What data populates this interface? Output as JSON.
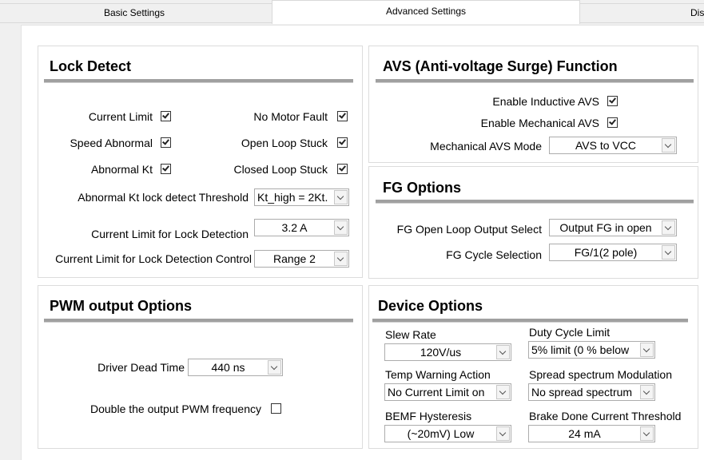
{
  "tabs": {
    "basic": "Basic Settings",
    "advanced": "Advanced Settings",
    "third": "Dis"
  },
  "lock_detect": {
    "title": "Lock Detect",
    "current_limit": {
      "label": "Current Limit",
      "checked": true
    },
    "no_motor_fault": {
      "label": "No Motor Fault",
      "checked": true
    },
    "speed_abnormal": {
      "label": "Speed Abnormal",
      "checked": true
    },
    "open_loop_stuck": {
      "label": "Open Loop Stuck",
      "checked": true
    },
    "abnormal_kt": {
      "label": "Abnormal Kt",
      "checked": true
    },
    "closed_loop_stuck": {
      "label": "Closed Loop Stuck",
      "checked": true
    },
    "kt_threshold": {
      "label": "Abnormal Kt lock detect Threshold",
      "value": "Kt_high = 2Kt."
    },
    "cl_lock_detection": {
      "label": "Current Limit for Lock Detection",
      "value": "3.2 A"
    },
    "cl_lock_detection_control": {
      "label": "Current Limit for Lock Detection Control",
      "value": "Range 2"
    }
  },
  "avs": {
    "title": "AVS (Anti-voltage Surge) Function",
    "inductive": {
      "label": "Enable Inductive AVS",
      "checked": true
    },
    "mechanical": {
      "label": "Enable Mechanical AVS",
      "checked": true
    },
    "mode": {
      "label": "Mechanical AVS Mode",
      "value": "AVS to VCC"
    }
  },
  "fg": {
    "title": "FG Options",
    "open_loop_select": {
      "label": "FG Open Loop Output Select",
      "value": "Output FG in open"
    },
    "cycle_selection": {
      "label": "FG Cycle Selection",
      "value": "FG/1(2 pole)"
    }
  },
  "pwm": {
    "title": "PWM output Options",
    "dead_time": {
      "label": "Driver Dead Time",
      "value": "440 ns"
    },
    "double_freq": {
      "label": "Double the output PWM frequency",
      "checked": false
    }
  },
  "device": {
    "title": "Device Options",
    "slew_rate": {
      "label": "Slew Rate",
      "value": "120V/us"
    },
    "duty_cycle_limit": {
      "label": "Duty Cycle Limit",
      "value": "5% limit (0 % below"
    },
    "temp_warning": {
      "label": "Temp Warning Action",
      "value": "No Current Limit on"
    },
    "spread_spectrum": {
      "label": "Spread spectrum Modulation",
      "value": "No spread spectrum"
    },
    "bemf_hysteresis": {
      "label": "BEMF Hysteresis",
      "value": "(~20mV) Low"
    },
    "brake_done": {
      "label": "Brake Done Current Threshold",
      "value": "24 mA"
    }
  }
}
